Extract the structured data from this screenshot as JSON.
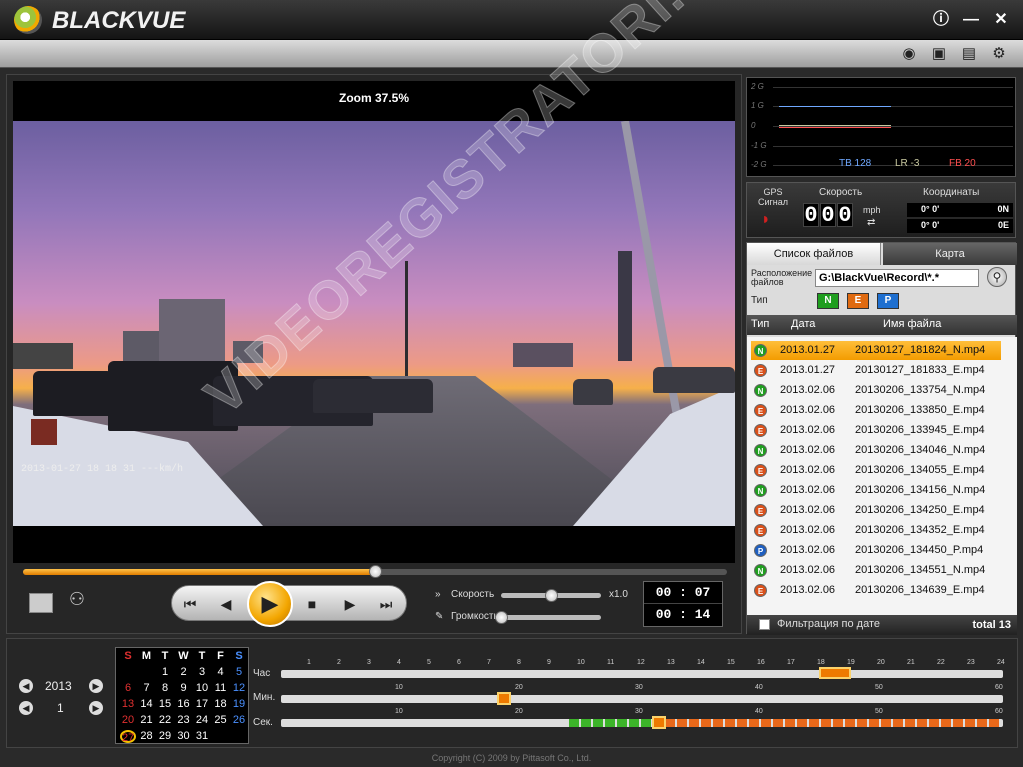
{
  "app": {
    "name": "BLACKVUE"
  },
  "window": {
    "info_icon": "info-icon",
    "minimize_icon": "minimize-icon",
    "close_icon": "close-icon"
  },
  "toolbar": {
    "icons": [
      "map-pin-icon",
      "camera-icon",
      "print-icon",
      "gear-icon"
    ]
  },
  "video": {
    "zoom": "Zoom 37.5%",
    "osd": "2013-01-27 18 18 31  ---km/h",
    "watermark": "VIDEOREGISTRATORI.RU",
    "progress": 0.5
  },
  "controls": {
    "speed_label": "Скорость",
    "speed_value": "x1.0",
    "speed_level": 0.5,
    "volume_label": "Громкость",
    "volume_level": 0.0,
    "time_current": "00 : 07",
    "time_total": "00 : 14"
  },
  "graph": {
    "labels": [
      "2 G",
      "1 G",
      "0",
      "-1 G",
      "-2 G"
    ],
    "tb": "TB 128",
    "lr": "LR -3",
    "fb": "FB 20",
    "colors": {
      "tb": "#6fa8ff",
      "lr": "#c9c9a0",
      "fb": "#ff5050"
    }
  },
  "gps": {
    "signal_label": "GPS Сигнал",
    "speed_label": "Скорость",
    "speed_digits": [
      "0",
      "0",
      "0"
    ],
    "unit": "mph",
    "coords_label": "Координаты",
    "lat": "0°  0'",
    "lat_dir": "0N",
    "lon": "0°  0'",
    "lon_dir": "0E"
  },
  "files": {
    "tab_list": "Список файлов",
    "tab_map": "Карта",
    "location_label": "Расположение файлов",
    "path": "G:\\BlackVue\\Record\\*.*",
    "type_label": "Тип",
    "types": [
      {
        "label": "N",
        "color": "#1f9e1f"
      },
      {
        "label": "E",
        "color": "#e06a10"
      },
      {
        "label": "P",
        "color": "#1e6fd0"
      }
    ],
    "headers": {
      "type": "Тип",
      "date": "Дата",
      "name": "Имя файла"
    },
    "rows": [
      {
        "t": "N",
        "date": "2013.01.27",
        "name": "20130127_181824_N.mp4"
      },
      {
        "t": "E",
        "date": "2013.01.27",
        "name": "20130127_181833_E.mp4"
      },
      {
        "t": "N",
        "date": "2013.02.06",
        "name": "20130206_133754_N.mp4"
      },
      {
        "t": "E",
        "date": "2013.02.06",
        "name": "20130206_133850_E.mp4"
      },
      {
        "t": "E",
        "date": "2013.02.06",
        "name": "20130206_133945_E.mp4"
      },
      {
        "t": "N",
        "date": "2013.02.06",
        "name": "20130206_134046_N.mp4"
      },
      {
        "t": "E",
        "date": "2013.02.06",
        "name": "20130206_134055_E.mp4"
      },
      {
        "t": "N",
        "date": "2013.02.06",
        "name": "20130206_134156_N.mp4"
      },
      {
        "t": "E",
        "date": "2013.02.06",
        "name": "20130206_134250_E.mp4"
      },
      {
        "t": "E",
        "date": "2013.02.06",
        "name": "20130206_134352_E.mp4"
      },
      {
        "t": "P",
        "date": "2013.02.06",
        "name": "20130206_134450_P.mp4"
      },
      {
        "t": "N",
        "date": "2013.02.06",
        "name": "20130206_134551_N.mp4"
      },
      {
        "t": "E",
        "date": "2013.02.06",
        "name": "20130206_134639_E.mp4"
      }
    ],
    "filter_label": "Фильтрация по дате",
    "total": "total 13"
  },
  "calendar": {
    "year": "2013",
    "month": "1",
    "days_header": [
      "S",
      "M",
      "T",
      "W",
      "T",
      "F",
      "S"
    ],
    "weeks": [
      [
        "",
        "",
        "",
        "1",
        "2",
        "3",
        "4",
        "5"
      ],
      [
        "",
        "6",
        "7",
        "8",
        "9",
        "10",
        "11",
        "12"
      ],
      [
        "",
        "13",
        "14",
        "15",
        "16",
        "17",
        "18",
        "19"
      ],
      [
        "",
        "20",
        "21",
        "22",
        "23",
        "24",
        "25",
        "26"
      ],
      [
        "",
        "27",
        "28",
        "29",
        "30",
        "31",
        "",
        ""
      ]
    ]
  },
  "timeline": {
    "hour_label": "Час",
    "min_label": "Мин.",
    "sec_label": "Сек.",
    "hours": [
      "1",
      "2",
      "3",
      "4",
      "5",
      "6",
      "7",
      "8",
      "9",
      "10",
      "11",
      "12",
      "13",
      "14",
      "15",
      "16",
      "17",
      "18",
      "19",
      "20",
      "21",
      "22",
      "23",
      "24"
    ],
    "minutes": [
      "10",
      "20",
      "30",
      "40",
      "50",
      "60"
    ],
    "seconds": [
      "10",
      "20",
      "30",
      "40",
      "50",
      "60"
    ]
  },
  "copyright": "Copyright (C) 2009 by Pittasoft Co., Ltd."
}
